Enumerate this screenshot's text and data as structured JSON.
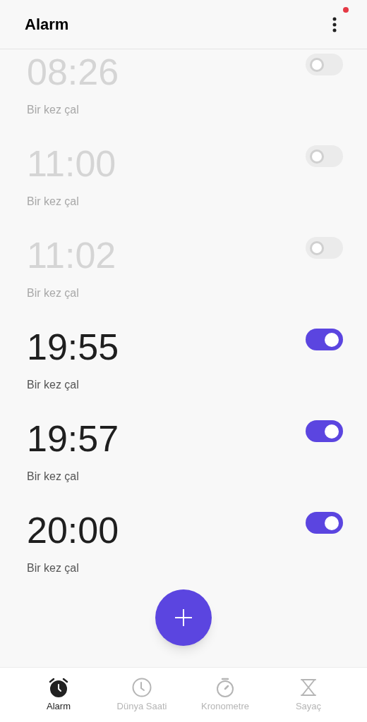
{
  "header": {
    "title": "Alarm",
    "menu_badge": true
  },
  "alarms": [
    {
      "time": "08:26",
      "repeat": "Bir kez çal",
      "on": false
    },
    {
      "time": "11:00",
      "repeat": "Bir kez çal",
      "on": false
    },
    {
      "time": "11:02",
      "repeat": "Bir kez çal",
      "on": false
    },
    {
      "time": "19:55",
      "repeat": "Bir kez çal",
      "on": true
    },
    {
      "time": "19:57",
      "repeat": "Bir kez çal",
      "on": true
    },
    {
      "time": "20:00",
      "repeat": "Bir kez çal",
      "on": true
    }
  ],
  "tabs": [
    {
      "label": "Alarm",
      "kind": "alarm",
      "selected": true
    },
    {
      "label": "Dünya Saati",
      "kind": "clock",
      "selected": false
    },
    {
      "label": "Kronometre",
      "kind": "stopwatch",
      "selected": false
    },
    {
      "label": "Sayaç",
      "kind": "timer",
      "selected": false
    }
  ]
}
